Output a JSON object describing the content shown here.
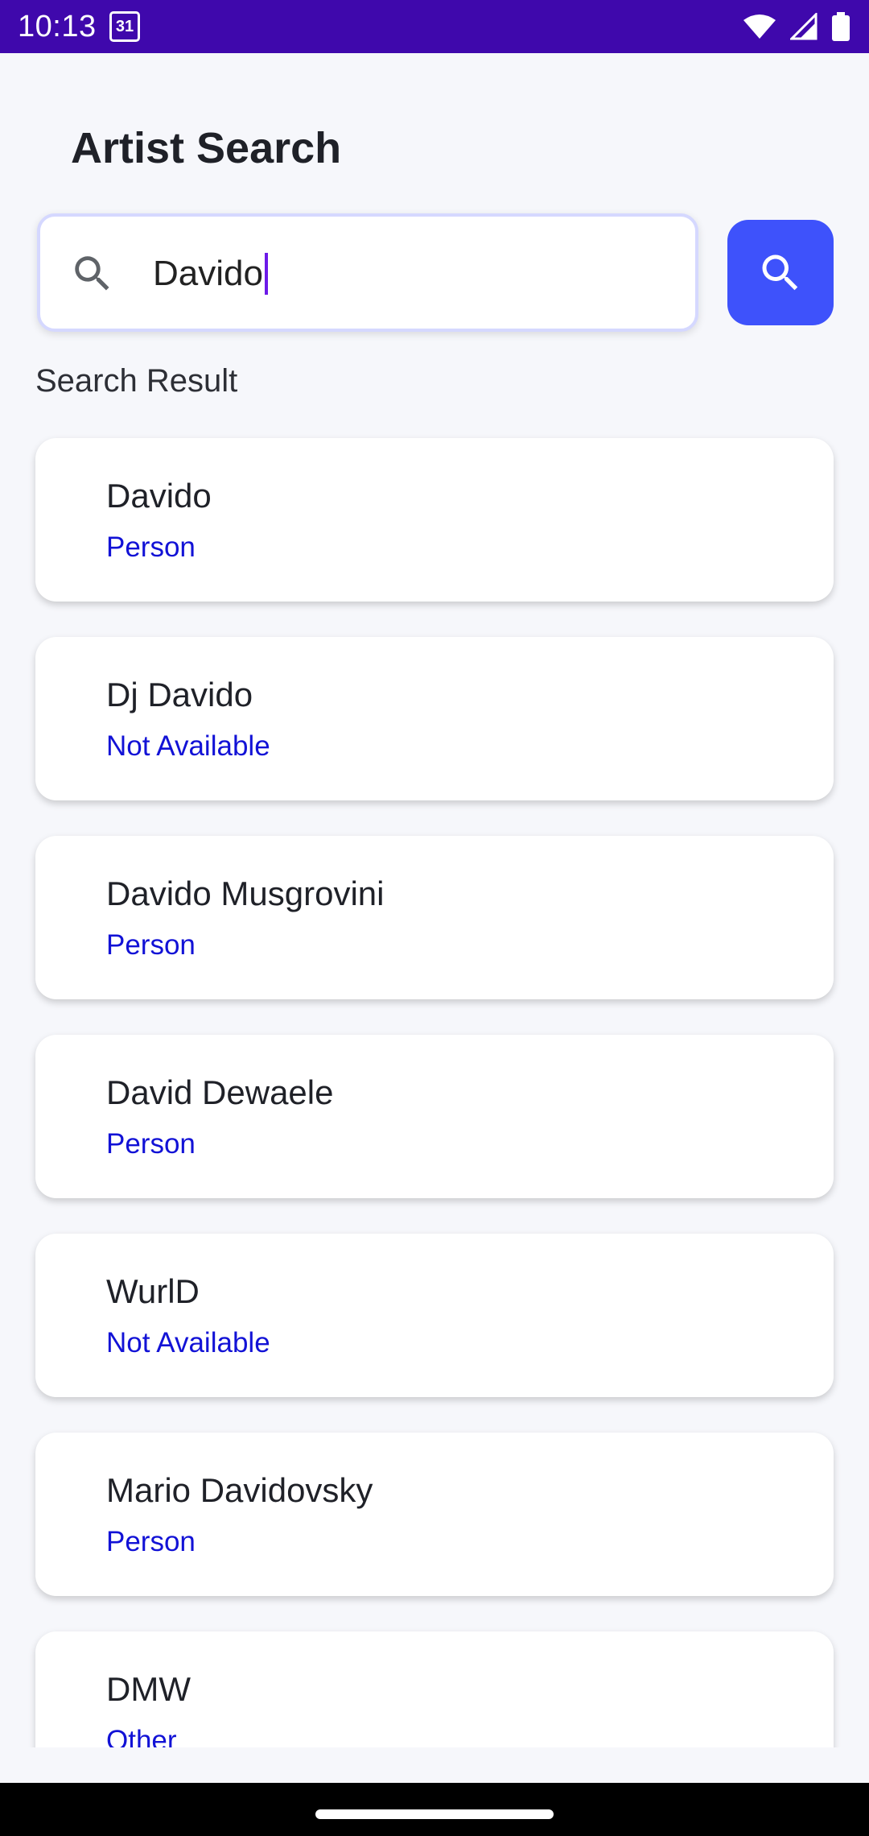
{
  "status_bar": {
    "time": "10:13",
    "calendar_day": "31",
    "icons": [
      "wifi-icon",
      "signal-icon",
      "battery-icon"
    ]
  },
  "page": {
    "title": "Artist Search"
  },
  "search": {
    "value": "Davido",
    "icon": "search-icon",
    "button_icon": "search-icon"
  },
  "results": {
    "label": "Search Result",
    "items": [
      {
        "name": "Davido",
        "type": "Person"
      },
      {
        "name": "Dj Davido",
        "type": "Not Available"
      },
      {
        "name": "Davido Musgrovini",
        "type": "Person"
      },
      {
        "name": "David Dewaele",
        "type": "Person"
      },
      {
        "name": "WurlD",
        "type": "Not Available"
      },
      {
        "name": "Mario Davidovsky",
        "type": "Person"
      },
      {
        "name": "DMW",
        "type": "Other"
      }
    ]
  },
  "colors": {
    "status_bar": "#3f08ac",
    "accent": "#3e52fb",
    "type_text": "#1212d6",
    "caret": "#6c1ae8"
  }
}
